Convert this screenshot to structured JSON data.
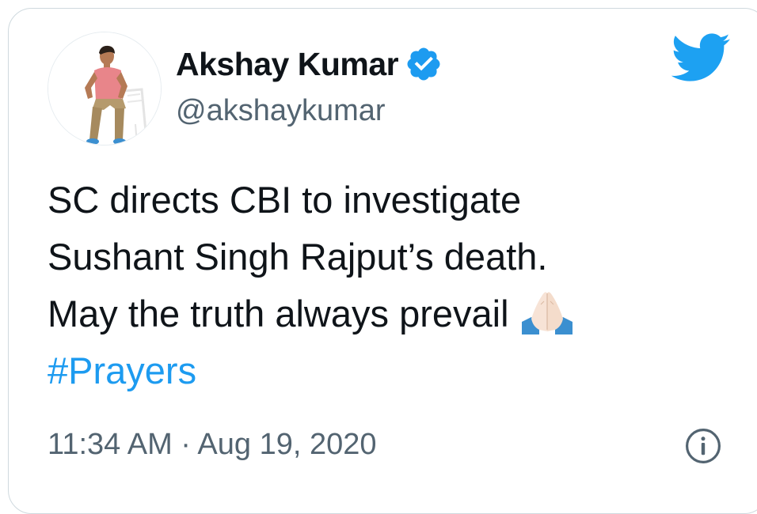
{
  "tweet": {
    "author": {
      "display_name": "Akshay Kumar",
      "handle": "@akshaykumar",
      "verified": true,
      "avatar_icon": "profile-photo"
    },
    "text_lines": [
      "SC directs CBI to investigate",
      "Sushant Singh Rajput’s death.",
      "May the truth always prevail"
    ],
    "emoji": "folded-hands-emoji",
    "hashtag": "#Prayers",
    "time": "11:34 AM",
    "separator": "·",
    "date": "Aug 19, 2020"
  },
  "icons": {
    "brand": "twitter-bird-icon",
    "verified": "verified-badge-icon",
    "info": "info-icon"
  },
  "colors": {
    "brand_blue": "#1da1f2",
    "link_blue": "#1d9bf0",
    "text_primary": "#0f1419",
    "text_secondary": "#536471",
    "border": "#cfd9de"
  }
}
